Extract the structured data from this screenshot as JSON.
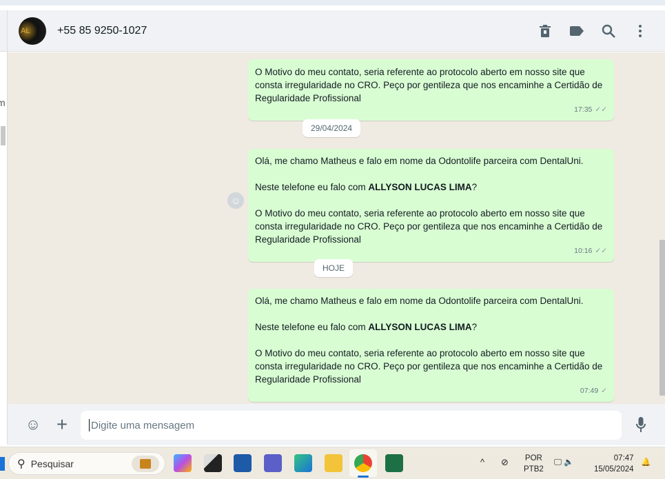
{
  "header": {
    "contact": "+55 85 9250-1027",
    "avatar_text": "AL"
  },
  "messages": [
    {
      "lines": [
        "O Motivo do meu contato, seria referente ao protocolo aberto em nosso site que consta irregularidade no CRO. Peço por gentileza que nos encaminhe a Certidão de Regularidade Profissional"
      ],
      "time": "17:35",
      "status": "✓✓"
    },
    {
      "greeting": "Olá, me chamo Matheus e falo em nome da Odontolife parceira com DentalUni.",
      "question_pre": "Neste telefone eu falo com ",
      "question_bold": "ALLYSON LUCAS LIMA",
      "question_post": "?",
      "body": "O Motivo do meu contato, seria referente ao protocolo aberto em nosso site que consta irregularidade no CRO. Peço por gentileza que nos encaminhe a Certidão de Regularidade Profissional",
      "time": "10:16",
      "status": "✓✓"
    },
    {
      "greeting": "Olá, me chamo Matheus e falo em nome da Odontolife parceira com DentalUni.",
      "question_pre": "Neste telefone eu falo com ",
      "question_bold": "ALLYSON LUCAS LIMA",
      "question_post": "?",
      "body": "O Motivo do meu contato, seria referente ao protocolo aberto em nosso site que consta irregularidade no CRO. Peço por gentileza que nos encaminhe a Certidão de Regularidade Profissional",
      "time": "07:49",
      "status": "✓"
    }
  ],
  "dates": [
    "29/04/2024",
    "HOJE"
  ],
  "composer": {
    "placeholder": "Digite uma mensagem"
  },
  "taskbar": {
    "search": "Pesquisar",
    "lang1": "POR",
    "lang2": "PTB2",
    "time": "07:47",
    "date": "15/05/2024"
  },
  "left": {
    "partial": "m"
  }
}
